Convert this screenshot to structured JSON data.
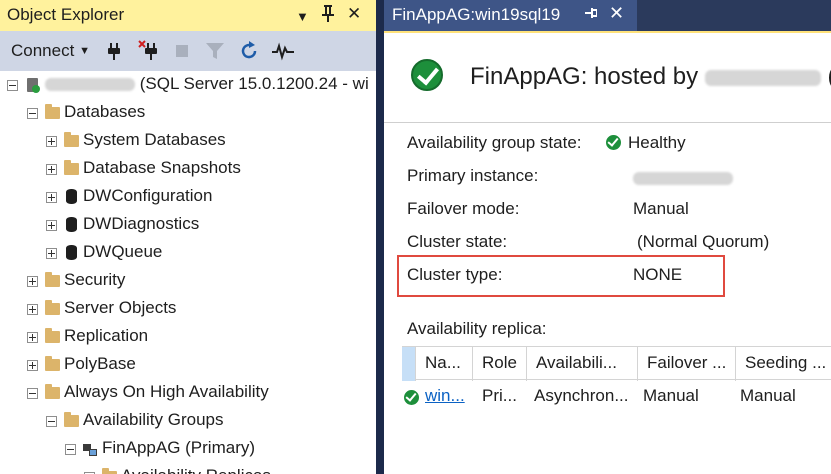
{
  "object_explorer": {
    "title": "Object Explorer",
    "title_buttons": {
      "dropdown": "▼",
      "pin": "📌",
      "close": "✕"
    },
    "toolbar": {
      "connect_label": "Connect",
      "tools": [
        "connect-icon",
        "disconnect-icon",
        "stop-icon",
        "filter-icon",
        "refresh-icon",
        "activity-monitor-icon"
      ]
    },
    "tree": {
      "server_suffix": "(SQL Server 15.0.1200.24 - wi",
      "databases": "Databases",
      "system_databases": "System Databases",
      "database_snapshots": "Database Snapshots",
      "db1": "DWConfiguration",
      "db2": "DWDiagnostics",
      "db3": "DWQueue",
      "security": "Security",
      "server_objects": "Server Objects",
      "replication": "Replication",
      "polybase": "PolyBase",
      "always_on": "Always On High Availability",
      "availability_groups": "Availability Groups",
      "finappag": "FinAppAG (Primary)",
      "next_item_partial": "Availability Replicas"
    }
  },
  "dashboard": {
    "tab_label": "FinAppAG:win19sql19",
    "title": "FinAppAG: hosted by",
    "title_suffix": "(",
    "properties": {
      "ag_state_label": "Availability group state:",
      "ag_state_value": "Healthy",
      "primary_instance_label": "Primary instance:",
      "failover_mode_label": "Failover mode:",
      "failover_mode_value": "Manual",
      "cluster_state_label": "Cluster state:",
      "cluster_state_value": "(Normal Quorum)",
      "cluster_type_label": "Cluster type:",
      "cluster_type_value": "NONE"
    },
    "replica_section_label": "Availability replica:",
    "grid": {
      "columns": [
        "Na...",
        "Role",
        "Availabili...",
        "Failover ...",
        "Seeding ..."
      ],
      "row": {
        "name": "win...",
        "role": "Pri...",
        "availability": "Asynchron...",
        "failover": "Manual",
        "seeding": "Manual"
      }
    }
  },
  "colors": {
    "oe_title_bg": "#fff29d",
    "toolbar_bg": "#cfd6e5",
    "tab_bg": "#3e5587",
    "healthy_green": "#1d8f3b",
    "highlight_red": "#e04a3f"
  }
}
